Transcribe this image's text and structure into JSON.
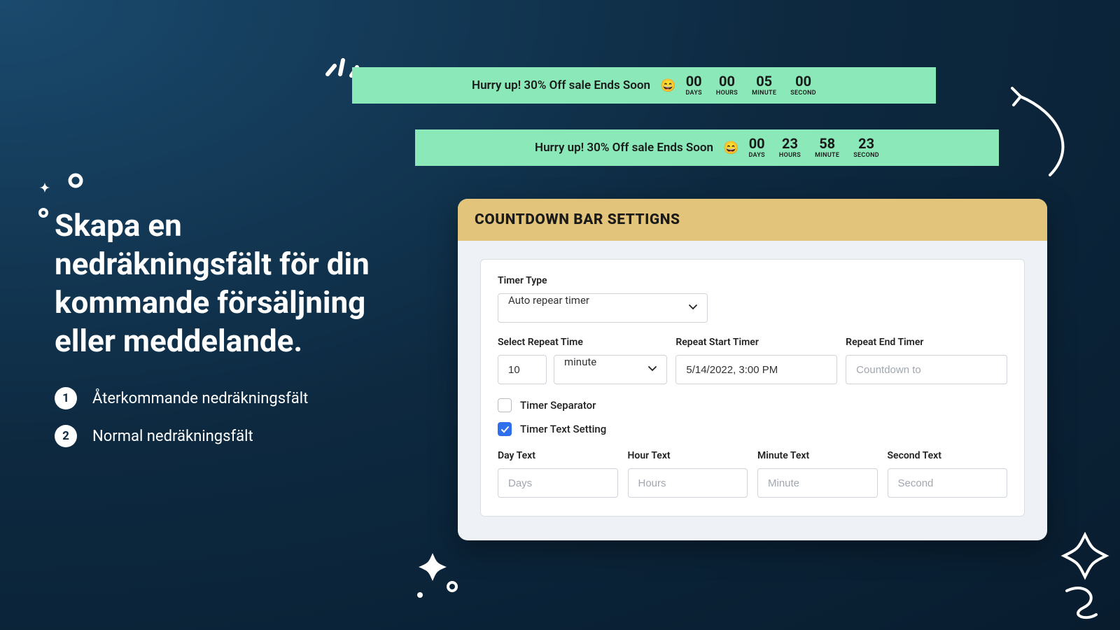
{
  "marketing": {
    "headline": "Skapa en nedräkningsfält för din kommande försäljning eller meddelande.",
    "features": [
      {
        "num": "1",
        "text": "Återkommande nedräkningsfält"
      },
      {
        "num": "2",
        "text": "Normal nedräkningsfält"
      }
    ]
  },
  "bars": {
    "message": "Hurry up! 30% Off sale Ends Soon",
    "emoji": "😄",
    "labels": {
      "days": "DAYS",
      "hours": "HOURS",
      "minute": "MINUTE",
      "second": "SECOND"
    },
    "bar1": {
      "d": "00",
      "h": "00",
      "m": "05",
      "s": "00"
    },
    "bar2": {
      "d": "00",
      "h": "23",
      "m": "58",
      "s": "23"
    }
  },
  "settings": {
    "title": "COUNTDOWN BAR SETTIGNS",
    "timer_type_label": "Timer Type",
    "timer_type_value": "Auto repear timer",
    "repeat_time_label": "Select Repeat Time",
    "repeat_time_value": "10",
    "repeat_time_unit": "minute",
    "repeat_start_label": "Repeat Start Timer",
    "repeat_start_value": "5/14/2022, 3:00 PM",
    "repeat_end_label": "Repeat End Timer",
    "repeat_end_placeholder": "Countdown to",
    "chk_separator_label": "Timer Separator",
    "chk_textsetting_label": "Timer Text Setting",
    "day_text_label": "Day Text",
    "day_text_placeholder": "Days",
    "hour_text_label": "Hour Text",
    "hour_text_placeholder": "Hours",
    "minute_text_label": "Minute Text",
    "minute_text_placeholder": "Minute",
    "second_text_label": "Second Text",
    "second_text_placeholder": "Second"
  }
}
